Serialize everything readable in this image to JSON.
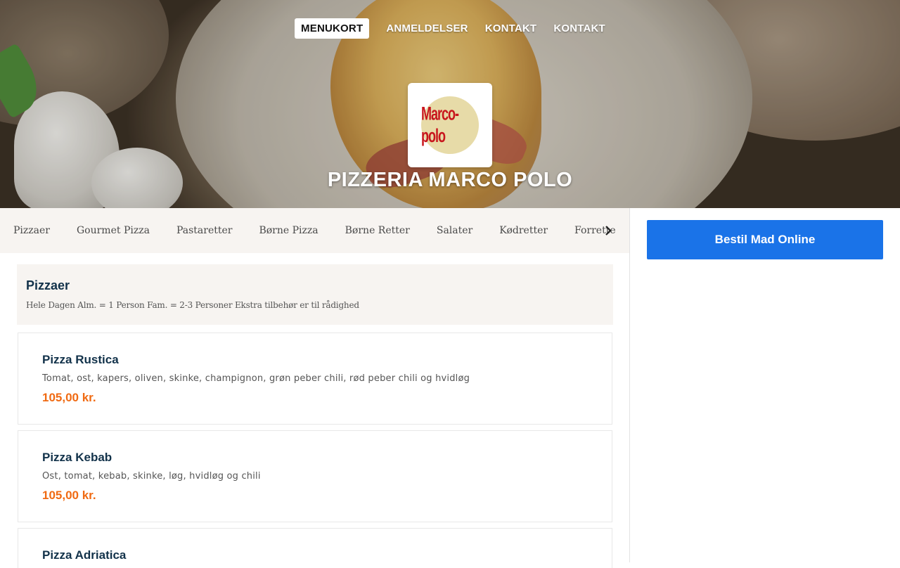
{
  "nav": {
    "items": [
      "MENUKORT",
      "ANMELDELSER",
      "KONTAKT",
      "KONTAKT"
    ]
  },
  "hero": {
    "logo_text": "Marco-polo",
    "title": "PIZZERIA MARCO POLO"
  },
  "categories": [
    "Pizzaer",
    "Gourmet Pizza",
    "Pastaretter",
    "Børne Pizza",
    "Børne Retter",
    "Salater",
    "Kødretter",
    "Forrette"
  ],
  "section": {
    "title": "Pizzaer",
    "description": "Hele Dagen Alm. = 1 Person Fam. = 2-3 Personer Ekstra tilbehør er til rådighed"
  },
  "items": [
    {
      "name": "Pizza Rustica",
      "description": "Tomat, ost, kapers, oliven, skinke, champignon, grøn peber chili, rød peber chili og hvidløg",
      "price": "105,00 kr."
    },
    {
      "name": "Pizza Kebab",
      "description": "Ost, tomat, kebab, skinke, løg, hvidløg og chili",
      "price": "105,00 kr."
    },
    {
      "name": "Pizza Adriatica",
      "description": "",
      "price": ""
    }
  ],
  "order_button": "Bestil Mad Online",
  "colors": {
    "accent_blue": "#1a73e8",
    "price_orange": "#f06a12",
    "title_navy": "#12324a",
    "panel_beige": "#f7f4f1"
  },
  "icons": {
    "scroll_right": "chevron-right-icon"
  }
}
